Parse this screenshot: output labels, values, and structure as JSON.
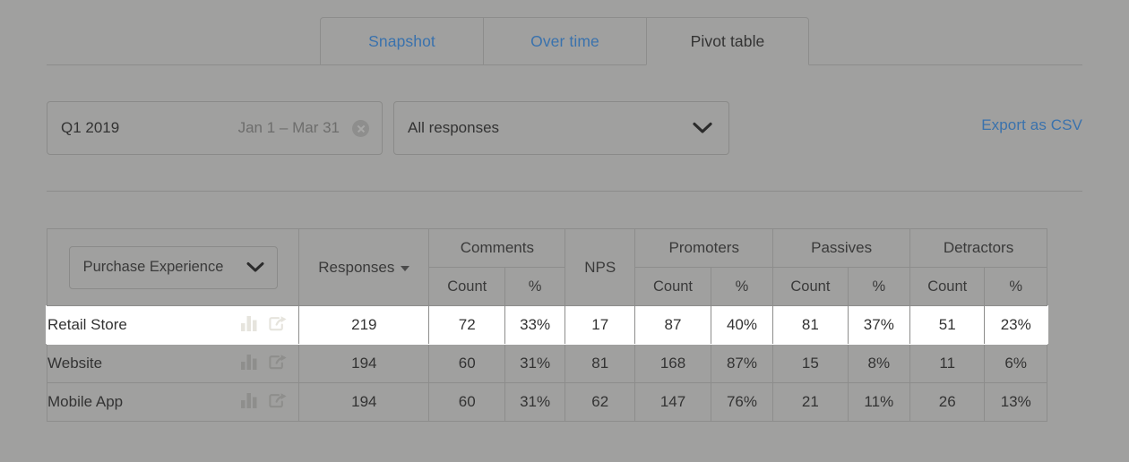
{
  "tabs": [
    {
      "label": "Snapshot",
      "active": false
    },
    {
      "label": "Over time",
      "active": false
    },
    {
      "label": "Pivot table",
      "active": true
    }
  ],
  "filters": {
    "date": {
      "label": "Q1 2019",
      "range": "Jan 1 – Mar 31",
      "clear_icon": "clear-circle-icon"
    },
    "responses": {
      "value": "All responses",
      "chevron_icon": "chevron-down-icon"
    },
    "export_label": "Export as CSV"
  },
  "table": {
    "dimension_select": {
      "label": "Purchase Experience",
      "chevron_icon": "chevron-down-icon"
    },
    "group_headers": [
      {
        "label": "Responses",
        "sorted": true,
        "sort_icon": "sort-desc-caret",
        "colspan": 1,
        "rowspan": 2
      },
      {
        "label": "Comments",
        "colspan": 2,
        "rowspan": 1
      },
      {
        "label": "NPS",
        "colspan": 1,
        "rowspan": 2
      },
      {
        "label": "Promoters",
        "colspan": 2,
        "rowspan": 1
      },
      {
        "label": "Passives",
        "colspan": 2,
        "rowspan": 1
      },
      {
        "label": "Detractors",
        "colspan": 2,
        "rowspan": 1
      }
    ],
    "sub_headers": [
      "Count",
      "%",
      "Count",
      "%",
      "Count",
      "%",
      "Count",
      "%"
    ],
    "row_icons": [
      "bar-chart-icon",
      "share-export-icon"
    ],
    "rows": [
      {
        "label": "Retail Store",
        "highlighted": true,
        "responses": "219",
        "comments_count": "72",
        "comments_pct": "33%",
        "nps": "17",
        "promoters_count": "87",
        "promoters_pct": "40%",
        "passives_count": "81",
        "passives_pct": "37%",
        "detractors_count": "51",
        "detractors_pct": "23%"
      },
      {
        "label": "Website",
        "highlighted": false,
        "responses": "194",
        "comments_count": "60",
        "comments_pct": "31%",
        "nps": "81",
        "promoters_count": "168",
        "promoters_pct": "87%",
        "passives_count": "15",
        "passives_pct": "8%",
        "detractors_count": "11",
        "detractors_pct": "6%"
      },
      {
        "label": "Mobile App",
        "highlighted": false,
        "responses": "194",
        "comments_count": "60",
        "comments_pct": "31%",
        "nps": "62",
        "promoters_count": "147",
        "promoters_pct": "76%",
        "passives_count": "21",
        "passives_pct": "11%",
        "detractors_count": "26",
        "detractors_pct": "13%"
      }
    ]
  },
  "colors": {
    "page_background": "#a0a09f",
    "link": "#3a72ad",
    "text": "#333333",
    "border": "#8d8d8c",
    "highlight_row": "#ffffff"
  }
}
